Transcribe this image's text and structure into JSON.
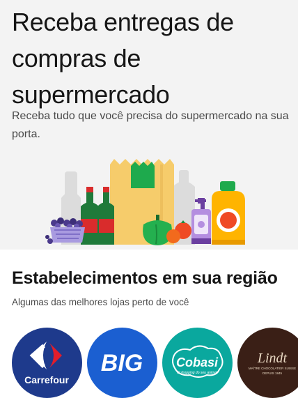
{
  "hero": {
    "title": "Receba entregas de compras de supermercado",
    "subtitle": "Receba tudo que você precisa do supermercado na sua porta."
  },
  "stores_section": {
    "title": "Estabelecimentos em sua região",
    "subtitle": "Algumas das melhores lojas perto de você"
  },
  "stores": [
    {
      "name": "Carrefour",
      "bg": "#1e3a8c"
    },
    {
      "name": "BIG",
      "bg": "#1b5fd1"
    },
    {
      "name": "Cobasi",
      "tagline": "O shopping do seu animal",
      "bg": "#0aa89e"
    },
    {
      "name": "Lindt",
      "tagline": "MAÎTRE CHOCOLATIER SUISSE",
      "since": "DEPUIS 1845",
      "bg": "#3a1f16"
    }
  ],
  "colors": {
    "hero_bg": "#f3f3f3",
    "accent_green": "#1eaa4d",
    "bag_yellow": "#f6cc6b"
  }
}
